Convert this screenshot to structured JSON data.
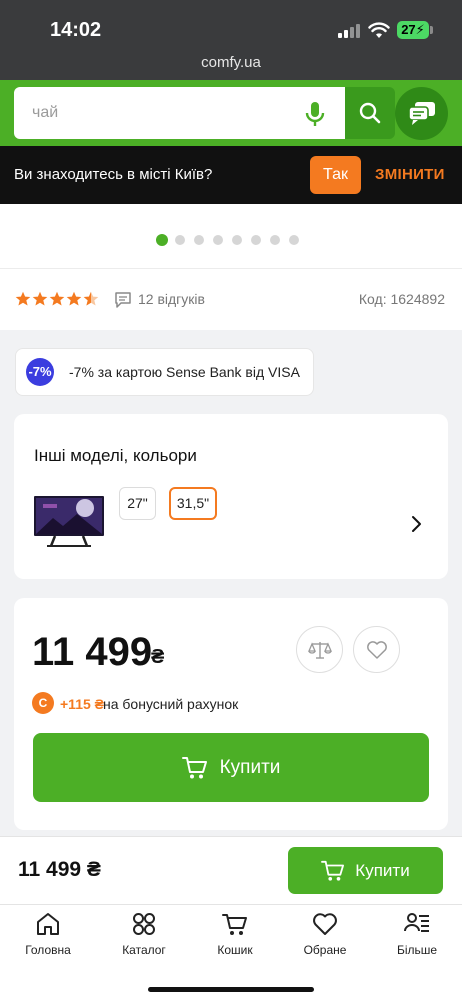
{
  "status_bar": {
    "time": "14:02",
    "battery": "27",
    "url": "comfy.ua"
  },
  "search": {
    "placeholder": "чай"
  },
  "city": {
    "text": "Ви знаходитесь в місті Київ?",
    "yes_label": "Так",
    "change_label": "ЗМІНИТИ"
  },
  "gallery": {
    "dot_count": 8,
    "active_index": 0
  },
  "rating": {
    "stars": 4.5,
    "reviews_text": "12 відгуків",
    "code_text": "Код: 1624892"
  },
  "promo": {
    "icon_text": "-7%",
    "text": "-7% за картою Sense Bank від VISA"
  },
  "models": {
    "title": "Інші моделі, кольори",
    "sizes": [
      {
        "label": "27\"",
        "selected": false
      },
      {
        "label": "31,5\"",
        "selected": true
      }
    ]
  },
  "price_card": {
    "price": "11 499",
    "currency": "₴",
    "bonus_amount": "+115 ₴",
    "bonus_text": "на бонусний рахунок",
    "buy_label": "Купити"
  },
  "sticky": {
    "price": "11 499 ₴",
    "buy_label": "Купити"
  },
  "bottom_nav": {
    "items": [
      {
        "label": "Головна",
        "icon": "home-icon"
      },
      {
        "label": "Каталог",
        "icon": "catalog-icon"
      },
      {
        "label": "Кошик",
        "icon": "cart-icon"
      },
      {
        "label": "Обране",
        "icon": "heart-icon"
      },
      {
        "label": "Більше",
        "icon": "more-icon"
      }
    ]
  },
  "colors": {
    "brand_green": "#4caf26",
    "accent_orange": "#f47a20",
    "promo_blue": "#3b3ddf"
  }
}
